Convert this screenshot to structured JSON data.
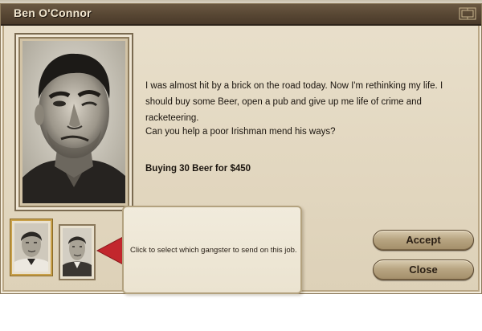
{
  "window": {
    "title": "Ben O'Connor"
  },
  "dialog": {
    "story": "I was almost hit by a brick on the road today. Now I'm rethinking my life. I should buy some Beer, open a pub and give up me life of crime and racketeering.",
    "question": "Can you help a poor Irishman mend his ways?",
    "deal": "Buying 30 Beer for $450"
  },
  "gangster_select": {
    "tooltip": "Click to select which gangster to send on this job.",
    "selected_index": 0
  },
  "buttons": {
    "accept_label": "Accept",
    "close_label": "Close"
  }
}
